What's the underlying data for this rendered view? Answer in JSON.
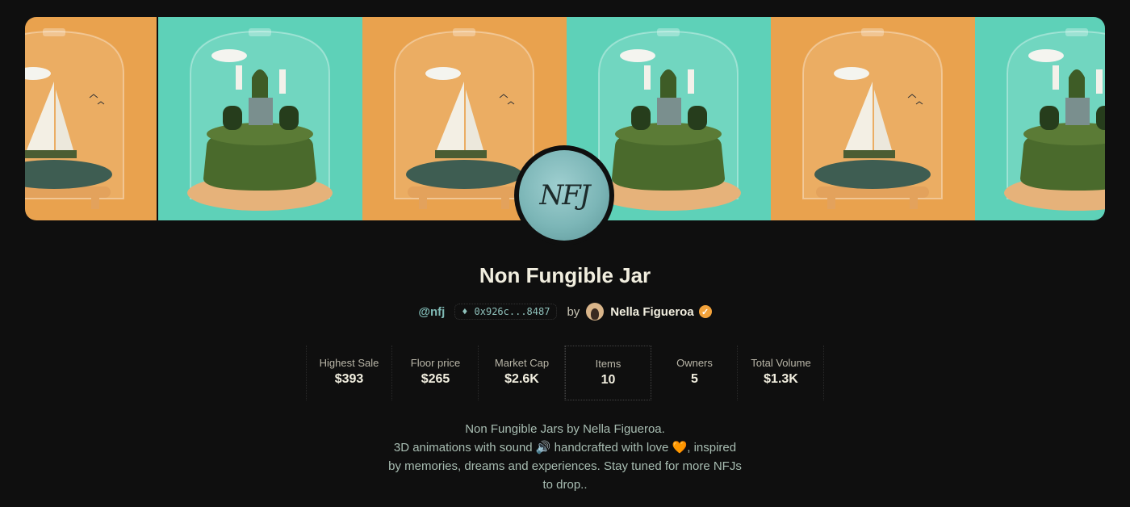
{
  "collection": {
    "title": "Non Fungible Jar",
    "handle": "@nfj",
    "address": "0x926c...8487",
    "by_label": "by",
    "creator": "Nella Figueroa",
    "logo_text": "NFJ"
  },
  "stats": [
    {
      "label": "Highest Sale",
      "value": "$393"
    },
    {
      "label": "Floor price",
      "value": "$265"
    },
    {
      "label": "Market Cap",
      "value": "$2.6K"
    },
    {
      "label": "Items",
      "value": "10"
    },
    {
      "label": "Owners",
      "value": "5"
    },
    {
      "label": "Total Volume",
      "value": "$1.3K"
    }
  ],
  "description": {
    "line1": "Non Fungible Jars by Nella Figueroa.",
    "line2": "3D animations with sound 🔊 handcrafted with love 🧡, inspired",
    "line3": "by memories, dreams and experiences. Stay tuned for more NFJs",
    "line4": "to drop.."
  },
  "colors": {
    "background": "#0f0f0f",
    "orange_tile": "#e9a24e",
    "teal_tile": "#5ed1b8",
    "accent_teal": "#7fb9b4",
    "verified": "#f2a23b"
  }
}
